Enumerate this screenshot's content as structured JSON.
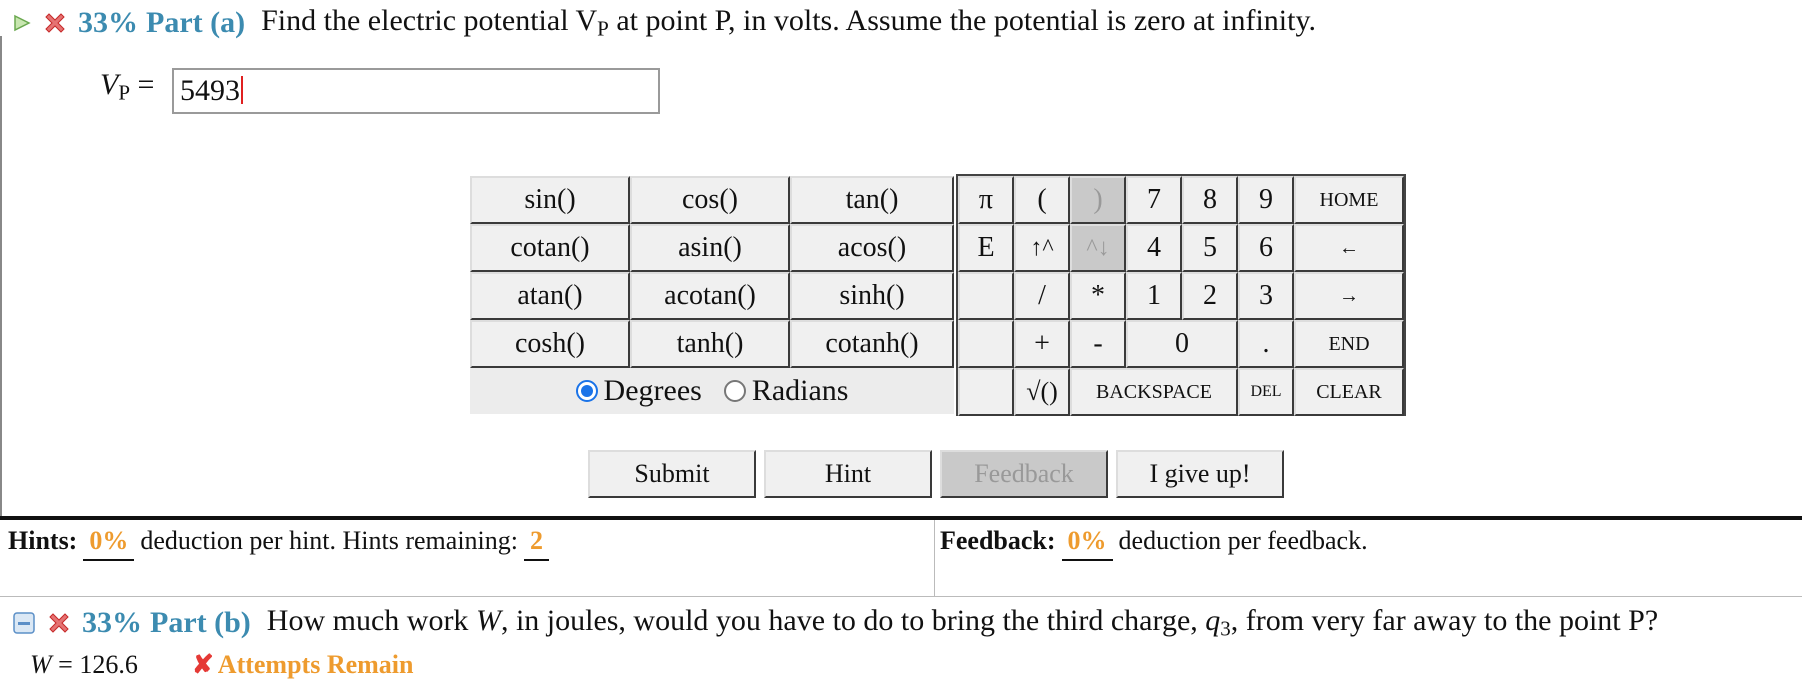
{
  "part_a": {
    "percent": "33%",
    "label": "Part (a)",
    "question": "Find the electric potential V",
    "question_sub": "P",
    "question_rest": " at point P, in volts. Assume the potential is zero at infinity."
  },
  "answer": {
    "var": "V",
    "var_sub": "P",
    "eq": " =",
    "value": "5493"
  },
  "keypad": {
    "functions": [
      [
        "sin()",
        "cos()",
        "tan()"
      ],
      [
        "cotan()",
        "asin()",
        "acos()"
      ],
      [
        "atan()",
        "acotan()",
        "sinh()"
      ],
      [
        "cosh()",
        "tanh()",
        "cotanh()"
      ]
    ],
    "symbols": {
      "pi": "π",
      "lparen": "(",
      "rparen": ")",
      "E": "E",
      "up": "↑^",
      "down": "^↓",
      "slash": "/",
      "star": "*",
      "plus": "+",
      "minus": "-",
      "sqrt": "√()",
      "backspace": "BACKSPACE",
      "del": "DEL",
      "clear": "CLEAR",
      "home": "HOME",
      "left": "←",
      "right": "→",
      "end": "END",
      "dot": "."
    },
    "digits": [
      "7",
      "8",
      "9",
      "4",
      "5",
      "6",
      "1",
      "2",
      "3",
      "0"
    ],
    "angle": {
      "degrees": "Degrees",
      "radians": "Radians",
      "selected": "Degrees"
    }
  },
  "actions": {
    "submit": "Submit",
    "hint": "Hint",
    "feedback": "Feedback",
    "give_up": "I give up!"
  },
  "hints": {
    "label": "Hints:",
    "pct": "0%",
    "text": "deduction per hint. Hints remaining:",
    "remaining": "2"
  },
  "feedback_info": {
    "label": "Feedback:",
    "pct": "0%",
    "text": "deduction per feedback."
  },
  "part_b": {
    "percent": "33%",
    "label": "Part (b)",
    "q1": "How much work ",
    "w": "W",
    "q2": ", in joules, would you have to do to bring the third charge, ",
    "q3var": "q",
    "q3sub": "3",
    "q4": ", from very far away to the point P?",
    "answer_var": "W",
    "answer_value": " = 126.6",
    "status": "Attempts Remain"
  },
  "colors": {
    "accent": "#3c8bb0",
    "orange": "#ee9b2e",
    "error": "#e53935",
    "radio": "#1a73e8"
  }
}
